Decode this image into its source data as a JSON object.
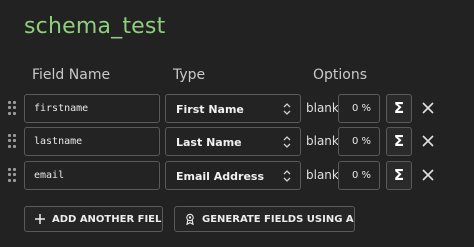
{
  "schema": {
    "title": "schema_test"
  },
  "columns": {
    "field_name": "Field Name",
    "type": "Type",
    "options": "Options"
  },
  "rows": [
    {
      "field_name": "firstname",
      "type": "First Name",
      "blank_label": "blank:",
      "blank_pct": "0 %",
      "sigma": "Σ"
    },
    {
      "field_name": "lastname",
      "type": "Last Name",
      "blank_label": "blank:",
      "blank_pct": "0 %",
      "sigma": "Σ"
    },
    {
      "field_name": "email",
      "type": "Email Address",
      "blank_label": "blank:",
      "blank_pct": "0 %",
      "sigma": "Σ"
    }
  ],
  "actions": {
    "add_field": "ADD ANOTHER FIELD",
    "generate_ai": "GENERATE FIELDS USING AI..."
  },
  "icons": {
    "drag": "drag-handle-icon",
    "chevron": "chevron-updown-icon",
    "close": "close-icon",
    "plus": "plus-icon",
    "ai": "ai-badge-icon"
  },
  "colors": {
    "title": "#8dcf7c",
    "background": "#222222",
    "border": "#5a5a5a"
  }
}
